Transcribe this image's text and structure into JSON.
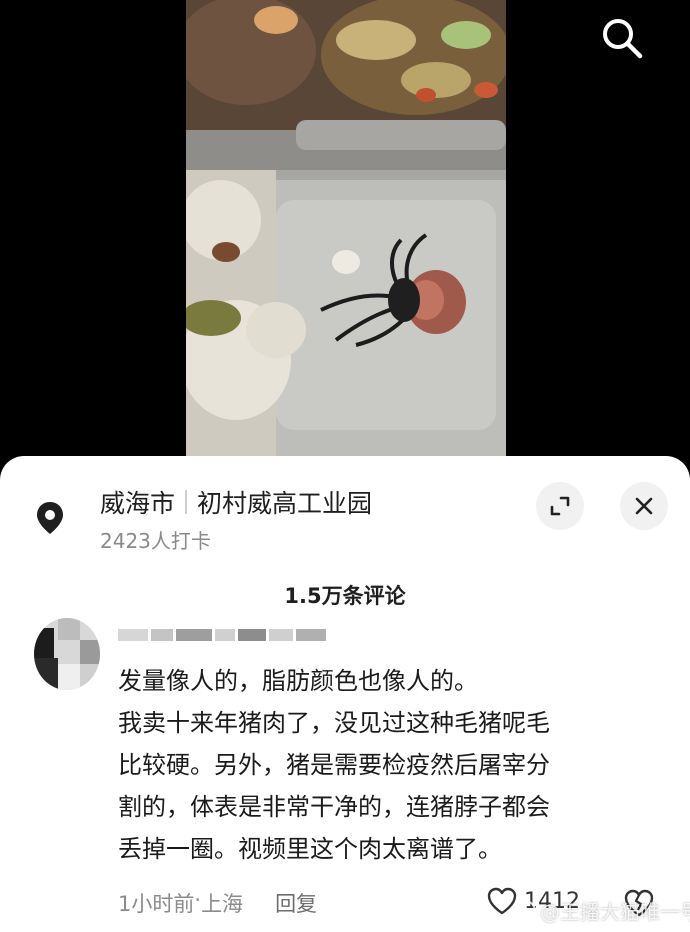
{
  "location": {
    "city": "威海市",
    "place": "初村威高工业园",
    "checkins": "2423人打卡"
  },
  "comments_header": {
    "count_label": "1.5万条评论"
  },
  "comment": {
    "lines": [
      "发量像人的，脂肪颜色也像人的。",
      "我卖十来年猪肉了，没见过这种毛猪呢毛",
      "比较硬。另外，猪是需要检疫然后屠宰分",
      "割的，体表是非常干净的，连猪脖子都会",
      "丢掉一圈。视频里这个肉太离谱了。"
    ],
    "time": "1小时前",
    "dot": " · ",
    "region": "上海",
    "reply_label": "回复",
    "likes": "1412"
  },
  "watermark": {
    "text": "@王播大猫唯一号"
  },
  "icons": {
    "search": "search-icon",
    "location": "location-pin-icon",
    "expand": "expand-icon",
    "close": "close-icon",
    "like": "heart-icon",
    "dislike": "broken-heart-icon"
  },
  "colors": {
    "sheet_bg": "#ffffff",
    "text_primary": "#1f1f1f",
    "text_secondary": "#8a8a8a",
    "button_bg": "#f1f1f1"
  }
}
